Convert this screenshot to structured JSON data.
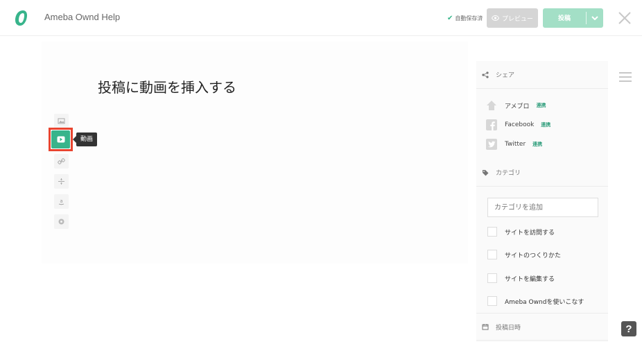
{
  "header": {
    "logo_glyph": "O",
    "site_name": "Ameba Ownd Help",
    "autosave_label": "自動保存済",
    "preview_label": "プレビュー",
    "post_label": "投稿",
    "accent_color": "#38b48b",
    "post_button_color": "#a3dfc6",
    "preview_button_color": "#d5d5d5"
  },
  "editor": {
    "title": "投稿に動画を挿入する",
    "tools": [
      {
        "name": "image-tool",
        "icon": "image-icon"
      },
      {
        "name": "video-tool",
        "icon": "play-icon",
        "selected": true
      },
      {
        "name": "link-tool",
        "icon": "link-icon"
      },
      {
        "name": "divider-tool",
        "icon": "divider-icon"
      },
      {
        "name": "amazon-tool",
        "icon": "amazon-icon"
      },
      {
        "name": "more-tool",
        "icon": "circle-icon"
      }
    ],
    "tooltip": "動画",
    "highlight_color": "#e9442f"
  },
  "sidebar": {
    "share": {
      "heading": "シェア",
      "items": [
        {
          "label": "アメブロ",
          "link": "連携"
        },
        {
          "label": "Facebook",
          "link": "連携"
        },
        {
          "label": "Twitter",
          "link": "連携"
        }
      ]
    },
    "category": {
      "heading": "カテゴリ",
      "input_placeholder": "カテゴリを追加",
      "items": [
        "サイトを訪問する",
        "サイトのつくりかた",
        "サイトを編集する",
        "Ameba Owndを使いこなす"
      ]
    },
    "date": {
      "heading": "投稿日時"
    }
  },
  "help": {
    "label": "?"
  }
}
